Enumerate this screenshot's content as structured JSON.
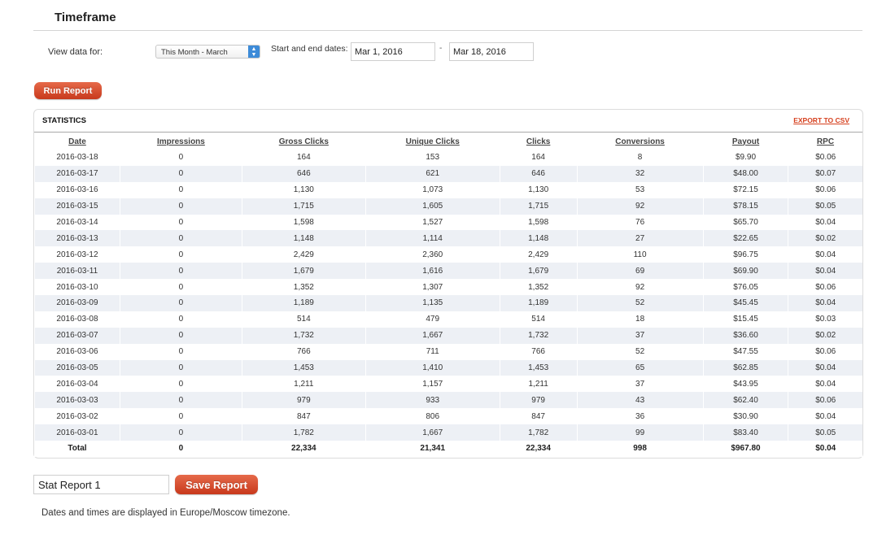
{
  "timeframe": {
    "title": "Timeframe",
    "view_label": "View data for:",
    "selected_period": "This Month - March",
    "dates_label": "Start and end dates:",
    "start_date": "Mar 1, 2016",
    "separator": "-",
    "end_date": "Mar 18, 2016",
    "run_label": "Run Report"
  },
  "statistics": {
    "title": "STATISTICS",
    "export_label": "EXPORT TO CSV",
    "columns": [
      "Date",
      "Impressions",
      "Gross Clicks",
      "Unique Clicks",
      "Clicks",
      "Conversions",
      "Payout",
      "RPC"
    ],
    "rows": [
      [
        "2016-03-18",
        "0",
        "164",
        "153",
        "164",
        "8",
        "$9.90",
        "$0.06"
      ],
      [
        "2016-03-17",
        "0",
        "646",
        "621",
        "646",
        "32",
        "$48.00",
        "$0.07"
      ],
      [
        "2016-03-16",
        "0",
        "1,130",
        "1,073",
        "1,130",
        "53",
        "$72.15",
        "$0.06"
      ],
      [
        "2016-03-15",
        "0",
        "1,715",
        "1,605",
        "1,715",
        "92",
        "$78.15",
        "$0.05"
      ],
      [
        "2016-03-14",
        "0",
        "1,598",
        "1,527",
        "1,598",
        "76",
        "$65.70",
        "$0.04"
      ],
      [
        "2016-03-13",
        "0",
        "1,148",
        "1,114",
        "1,148",
        "27",
        "$22.65",
        "$0.02"
      ],
      [
        "2016-03-12",
        "0",
        "2,429",
        "2,360",
        "2,429",
        "110",
        "$96.75",
        "$0.04"
      ],
      [
        "2016-03-11",
        "0",
        "1,679",
        "1,616",
        "1,679",
        "69",
        "$69.90",
        "$0.04"
      ],
      [
        "2016-03-10",
        "0",
        "1,352",
        "1,307",
        "1,352",
        "92",
        "$76.05",
        "$0.06"
      ],
      [
        "2016-03-09",
        "0",
        "1,189",
        "1,135",
        "1,189",
        "52",
        "$45.45",
        "$0.04"
      ],
      [
        "2016-03-08",
        "0",
        "514",
        "479",
        "514",
        "18",
        "$15.45",
        "$0.03"
      ],
      [
        "2016-03-07",
        "0",
        "1,732",
        "1,667",
        "1,732",
        "37",
        "$36.60",
        "$0.02"
      ],
      [
        "2016-03-06",
        "0",
        "766",
        "711",
        "766",
        "52",
        "$47.55",
        "$0.06"
      ],
      [
        "2016-03-05",
        "0",
        "1,453",
        "1,410",
        "1,453",
        "65",
        "$62.85",
        "$0.04"
      ],
      [
        "2016-03-04",
        "0",
        "1,211",
        "1,157",
        "1,211",
        "37",
        "$43.95",
        "$0.04"
      ],
      [
        "2016-03-03",
        "0",
        "979",
        "933",
        "979",
        "43",
        "$62.40",
        "$0.06"
      ],
      [
        "2016-03-02",
        "0",
        "847",
        "806",
        "847",
        "36",
        "$30.90",
        "$0.04"
      ],
      [
        "2016-03-01",
        "0",
        "1,782",
        "1,667",
        "1,782",
        "99",
        "$83.40",
        "$0.05"
      ]
    ],
    "totals": [
      "Total",
      "0",
      "22,334",
      "21,341",
      "22,334",
      "998",
      "$967.80",
      "$0.04"
    ]
  },
  "report": {
    "name_value": "Stat Report 1",
    "save_label": "Save Report"
  },
  "footer": {
    "timezone_note": "Dates and times are displayed in Europe/Moscow timezone."
  },
  "colors": {
    "accent_red": "#d6401e",
    "select_blue": "#3d8bd8",
    "row_stripe": "#edf0f5"
  },
  "icons": {
    "select_arrows": "chevron-up-down-icon"
  }
}
